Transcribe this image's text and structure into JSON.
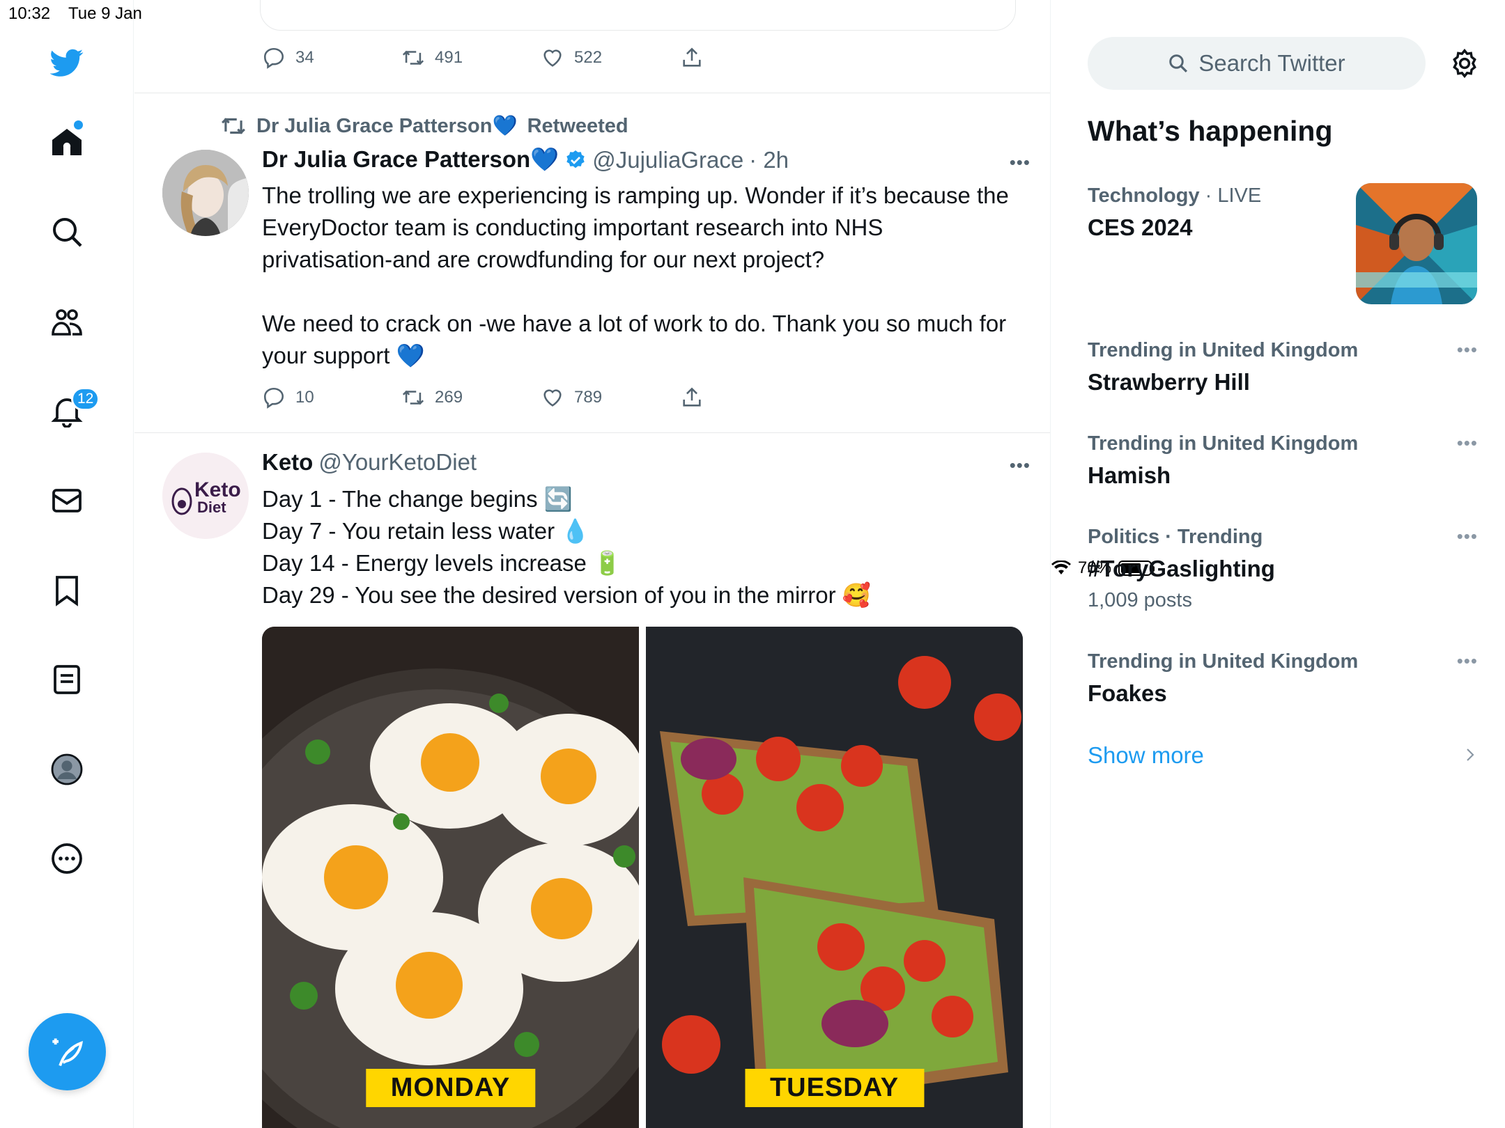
{
  "status": {
    "time": "10:32",
    "date": "Tue 9 Jan",
    "battery": "70%",
    "battery_level": 0.7
  },
  "sidebar": {
    "notifications_badge": "12",
    "items": [
      {
        "icon": "twitter-bird-icon"
      },
      {
        "icon": "home-icon"
      },
      {
        "icon": "search-icon"
      },
      {
        "icon": "communities-icon"
      },
      {
        "icon": "bell-icon"
      },
      {
        "icon": "mail-icon"
      },
      {
        "icon": "bookmark-icon"
      },
      {
        "icon": "lists-icon"
      },
      {
        "icon": "profile-icon"
      },
      {
        "icon": "more-icon"
      }
    ],
    "compose_icon": "compose-icon"
  },
  "feed": {
    "prev_tweet": {
      "replies": "34",
      "retweets": "491",
      "likes": "522"
    },
    "tweet1": {
      "retweeted_by": "Dr Julia Grace Patterson💙",
      "retweeted_label": "Retweeted",
      "name": "Dr Julia Grace Patterson💙",
      "handle": "@JujuliaGrace",
      "time": "· 2h",
      "text_p1": "The trolling we are experiencing is ramping up. Wonder if it’s because the EveryDoctor team is conducting important research into NHS privatisation-and are crowdfunding for our next project?",
      "text_p2": "We need to crack on -we have a lot of work to do. Thank you so much for your support 💙",
      "replies": "10",
      "retweets": "269",
      "likes": "789"
    },
    "tweet2": {
      "name": "Keto",
      "handle": "@YourKetoDiet",
      "avatar_text_1": "Keto",
      "avatar_text_2": "Diet",
      "lines": [
        "Day 1 - The change begins 🔄",
        "Day 7 - You retain less water 💧",
        "Day 14 - Energy levels increase 🔋",
        "Day 29 - You see the desired version of you in the mirror 🥰"
      ],
      "image_labels": [
        "MONDAY",
        "TUESDAY"
      ]
    }
  },
  "right": {
    "search_placeholder": "Search Twitter",
    "section_title": "What’s happening",
    "trends": [
      {
        "context": "Technology",
        "context_extra": "· LIVE",
        "title": "CES 2024",
        "posts": ""
      },
      {
        "context": "Trending in United Kingdom",
        "context_extra": "",
        "title": "Strawberry Hill",
        "posts": ""
      },
      {
        "context": "Trending in United Kingdom",
        "context_extra": "",
        "title": "Hamish",
        "posts": ""
      },
      {
        "context": "Politics · Trending",
        "context_extra": "",
        "title": "#ToryGaslighting",
        "posts": "1,009 posts"
      },
      {
        "context": "Trending in United Kingdom",
        "context_extra": "",
        "title": "Foakes",
        "posts": ""
      }
    ],
    "show_more": "Show more"
  },
  "colors": {
    "accent": "#1d9bf0",
    "text": "#0f1419",
    "secondary": "#536471",
    "label_bg": "#ffd600"
  }
}
